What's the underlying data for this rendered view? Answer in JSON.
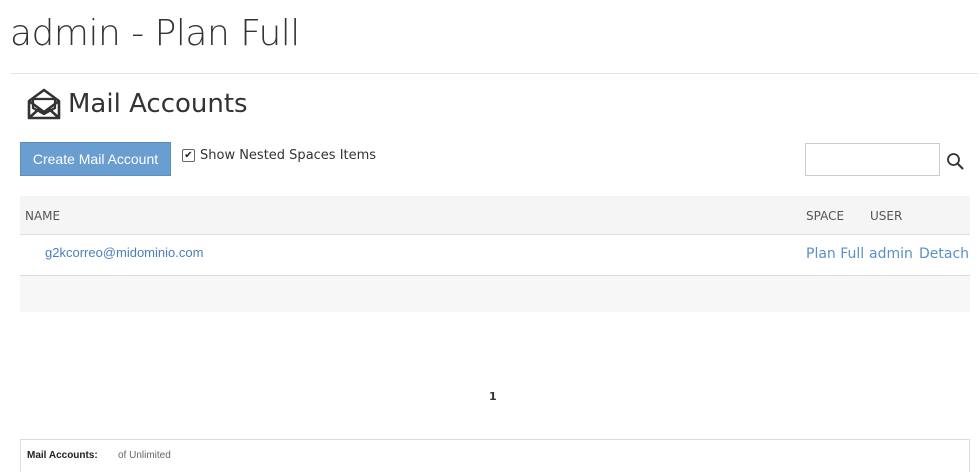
{
  "page": {
    "title": "admin - Plan Full"
  },
  "section": {
    "icon": "envelope-icon",
    "title": "Mail Accounts"
  },
  "toolbar": {
    "create_label": "Create Mail Account",
    "nested_label": "Show Nested Spaces Items",
    "nested_checked": true,
    "search_value": "",
    "search_placeholder": "",
    "search_icon": "search-icon"
  },
  "table": {
    "columns": {
      "name": "NAME",
      "space": "SPACE",
      "user": "USER"
    },
    "rows": [
      {
        "email": "g2kcorreo@midominio.com",
        "space": "Plan Full",
        "user": "admin",
        "action": "Detach"
      }
    ]
  },
  "pager": {
    "current": "1"
  },
  "quota": {
    "label": "Mail Accounts:",
    "value": "of Unlimited"
  },
  "colors": {
    "accent": "#6a9ed1",
    "link": "#5a8fc8"
  }
}
